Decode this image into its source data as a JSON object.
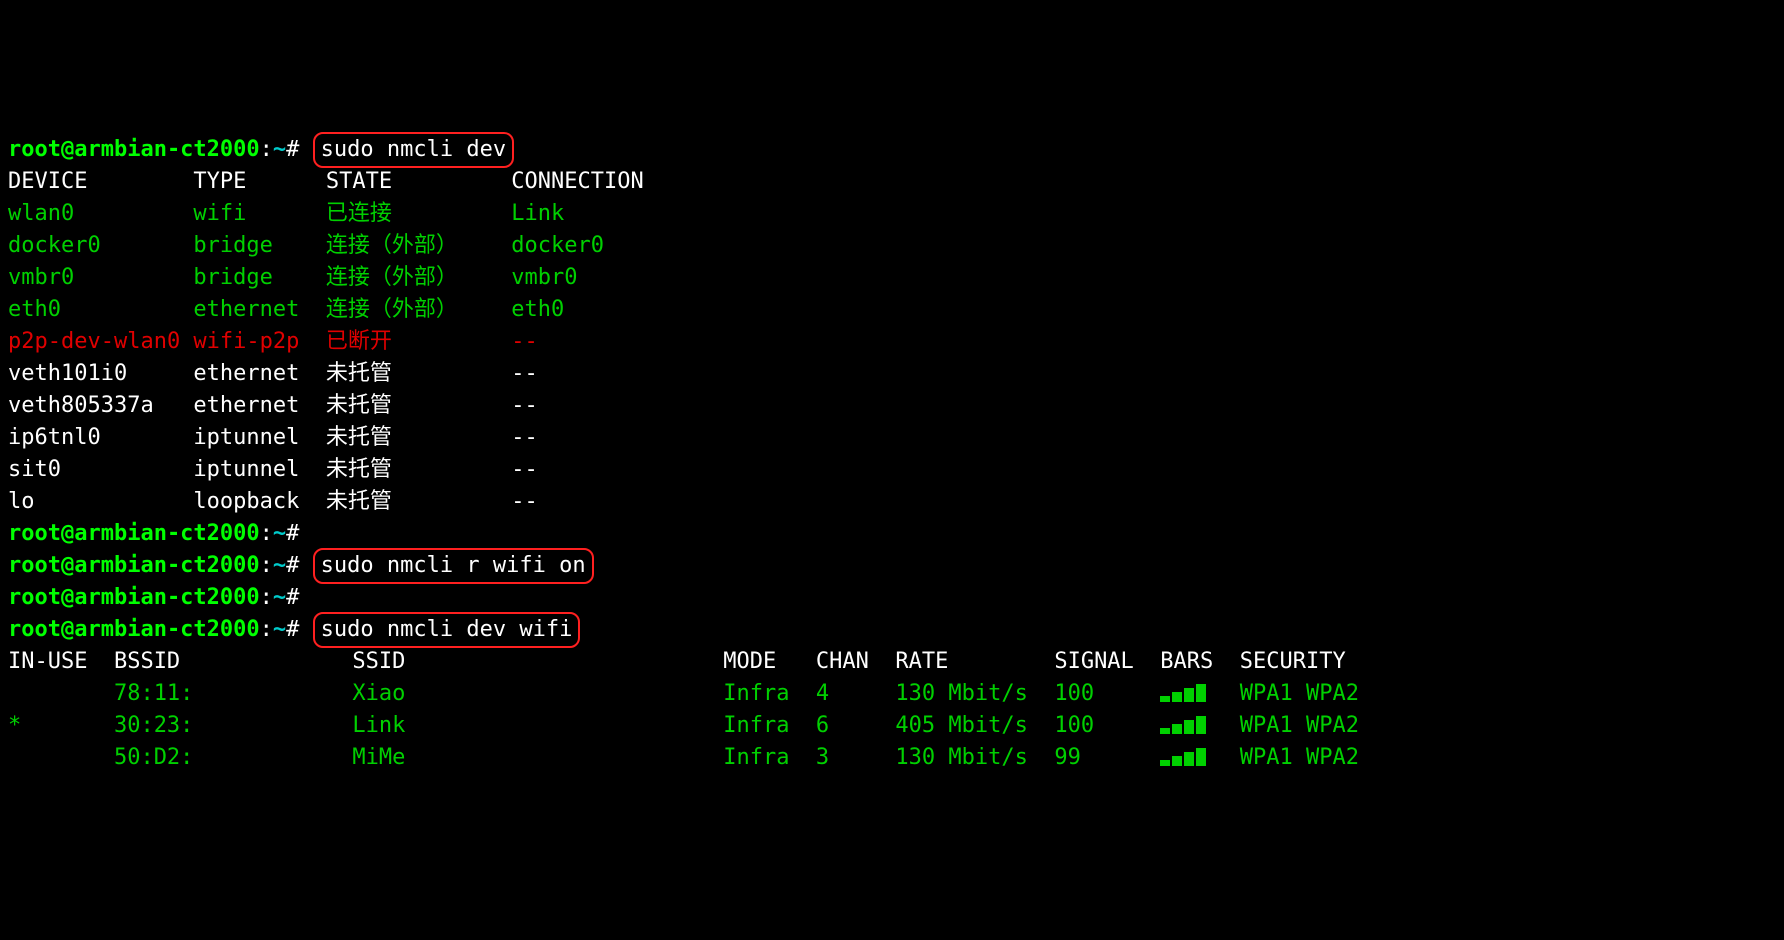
{
  "prompt": {
    "user_host": "root@armbian-ct2000",
    "colon": ":",
    "cwd": "~",
    "hash": "#"
  },
  "cmds": {
    "c1": "sudo nmcli dev",
    "c2": "sudo nmcli r wifi on",
    "c3": "sudo nmcli dev wifi"
  },
  "dev_table": {
    "headers": {
      "device": "DEVICE",
      "type": "TYPE",
      "state": "STATE",
      "conn": "CONNECTION"
    },
    "rows": [
      {
        "device": "wlan0",
        "type": "wifi",
        "state": "已连接",
        "conn": "Link",
        "color": "green"
      },
      {
        "device": "docker0",
        "type": "bridge",
        "state": "连接（外部）",
        "conn": "docker0",
        "color": "green"
      },
      {
        "device": "vmbr0",
        "type": "bridge",
        "state": "连接（外部）",
        "conn": "vmbr0",
        "color": "green"
      },
      {
        "device": "eth0",
        "type": "ethernet",
        "state": "连接（外部）",
        "conn": "eth0",
        "color": "green"
      },
      {
        "device": "p2p-dev-wlan0",
        "type": "wifi-p2p",
        "state": "已断开",
        "conn": "--",
        "color": "red"
      },
      {
        "device": "veth101i0",
        "type": "ethernet",
        "state": "未托管",
        "conn": "--",
        "color": ""
      },
      {
        "device": "veth805337a",
        "type": "ethernet",
        "state": "未托管",
        "conn": "--",
        "color": ""
      },
      {
        "device": "ip6tnl0",
        "type": "iptunnel",
        "state": "未托管",
        "conn": "--",
        "color": ""
      },
      {
        "device": "sit0",
        "type": "iptunnel",
        "state": "未托管",
        "conn": "--",
        "color": ""
      },
      {
        "device": "lo",
        "type": "loopback",
        "state": "未托管",
        "conn": "--",
        "color": ""
      }
    ]
  },
  "wifi_table": {
    "headers": {
      "inuse": "IN-USE",
      "bssid": "BSSID",
      "ssid": "SSID",
      "mode": "MODE",
      "chan": "CHAN",
      "rate": "RATE",
      "signal": "SIGNAL",
      "bars": "BARS",
      "security": "SECURITY"
    },
    "rows": [
      {
        "inuse": " ",
        "bssid": "78:11:",
        "ssid": "Xiao",
        "mode": "Infra",
        "chan": "4",
        "rate": "130 Mbit/s",
        "signal": "100",
        "bars_level": 4,
        "security": "WPA1 WPA2"
      },
      {
        "inuse": "*",
        "bssid": "30:23:",
        "ssid": "Link",
        "mode": "Infra",
        "chan": "6",
        "rate": "405 Mbit/s",
        "signal": "100",
        "bars_level": 4,
        "security": "WPA1 WPA2"
      },
      {
        "inuse": " ",
        "bssid": "50:D2:",
        "ssid": "MiMe",
        "mode": "Infra",
        "chan": "3",
        "rate": "130 Mbit/s",
        "signal": "99",
        "bars_level": 4,
        "security": "WPA1 WPA2"
      }
    ]
  }
}
